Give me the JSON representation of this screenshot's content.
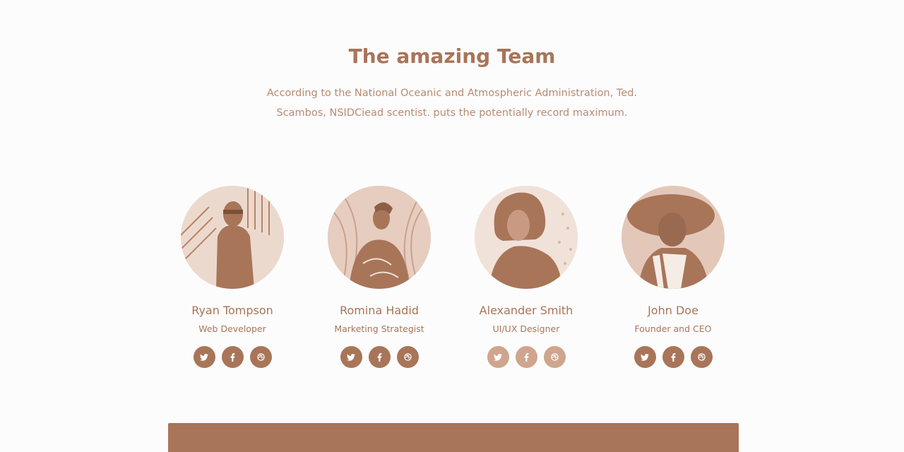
{
  "section": {
    "title": "The amazing Team",
    "description_line1": "According to the National Oceanic and Atmospheric Administration, Ted.",
    "description_line2": "Scambos, NSIDCiead scentist. puts the potentially record maximum."
  },
  "members": [
    {
      "name": "Ryan Tompson",
      "role": "Web Developer"
    },
    {
      "name": "Romina Hadid",
      "role": "Marketing Strategist"
    },
    {
      "name": "Alexander Smith",
      "role": "UI/UX Designer"
    },
    {
      "name": "John Doe",
      "role": "Founder and CEO"
    }
  ],
  "social_icons": [
    "twitter-icon",
    "facebook-icon",
    "dribbble-icon"
  ],
  "colors": {
    "accent": "#a87559",
    "accent_muted": "#cfa58d",
    "background": "#fdfcfc"
  }
}
